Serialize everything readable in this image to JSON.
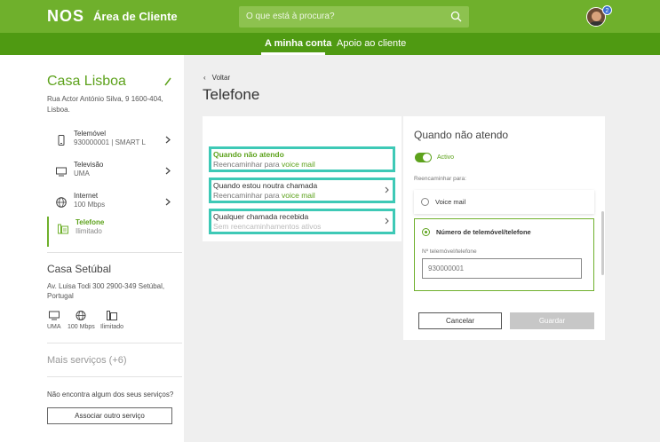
{
  "header": {
    "logo": "NOS",
    "title": "Área de Cliente",
    "search_placeholder": "O que está à procura?",
    "notification_count": "2",
    "brand_color": "#6fb02c"
  },
  "nav": {
    "tabs": [
      {
        "label": "A minha conta",
        "active": true
      },
      {
        "label": "Apoio ao cliente",
        "active": false
      }
    ]
  },
  "sidebar": {
    "home": {
      "name": "Casa Lisboa",
      "address": "Rua Actor António Silva, 9 1600-404, Lisboa.",
      "services": [
        {
          "name": "Telemóvel",
          "detail": "930000001 | SMART L",
          "icon": "phone-icon"
        },
        {
          "name": "Televisão",
          "detail": "UMA",
          "icon": "tv-icon"
        },
        {
          "name": "Internet",
          "detail": "100 Mbps",
          "icon": "globe-icon"
        },
        {
          "name": "Telefone",
          "detail": "Ilimitado",
          "icon": "landline-icon",
          "active": true
        }
      ]
    },
    "home2": {
      "name": "Casa Setúbal",
      "address": "Av. Luisa Todi 300 2900-349 Setúbal, Portugal",
      "services": [
        "UMA",
        "100 Mbps",
        "Ilimitado"
      ]
    },
    "more_services": "Mais serviços (+6)",
    "not_found": "Não encontra algum dos seus serviços?",
    "associate_button": "Associar outro serviço"
  },
  "main": {
    "back": "Voltar",
    "title": "Telefone",
    "options": [
      {
        "title": "Quando não atendo",
        "sub_prefix": "Reencaminhar para ",
        "sub_link": "voice mail"
      },
      {
        "title": "Quando estou noutra chamada",
        "sub_prefix": "Reencaminhar para ",
        "sub_link": "voice mail"
      },
      {
        "title": "Qualquer chamada recebida",
        "sub_prefix": "Sem reencaminhamentos ativos",
        "sub_link": ""
      }
    ],
    "detail": {
      "title": "Quando não atendo",
      "toggle_label": "Activo",
      "toggle_on": true,
      "redirect_label": "Reencaminhar para:",
      "radio_voicemail": "Voice mail",
      "radio_number": "Número de telemóvel/telefone",
      "field_label": "Nº telemóvel/telefone",
      "field_placeholder": "930000001",
      "cancel": "Cancelar",
      "save": "Guardar"
    }
  }
}
